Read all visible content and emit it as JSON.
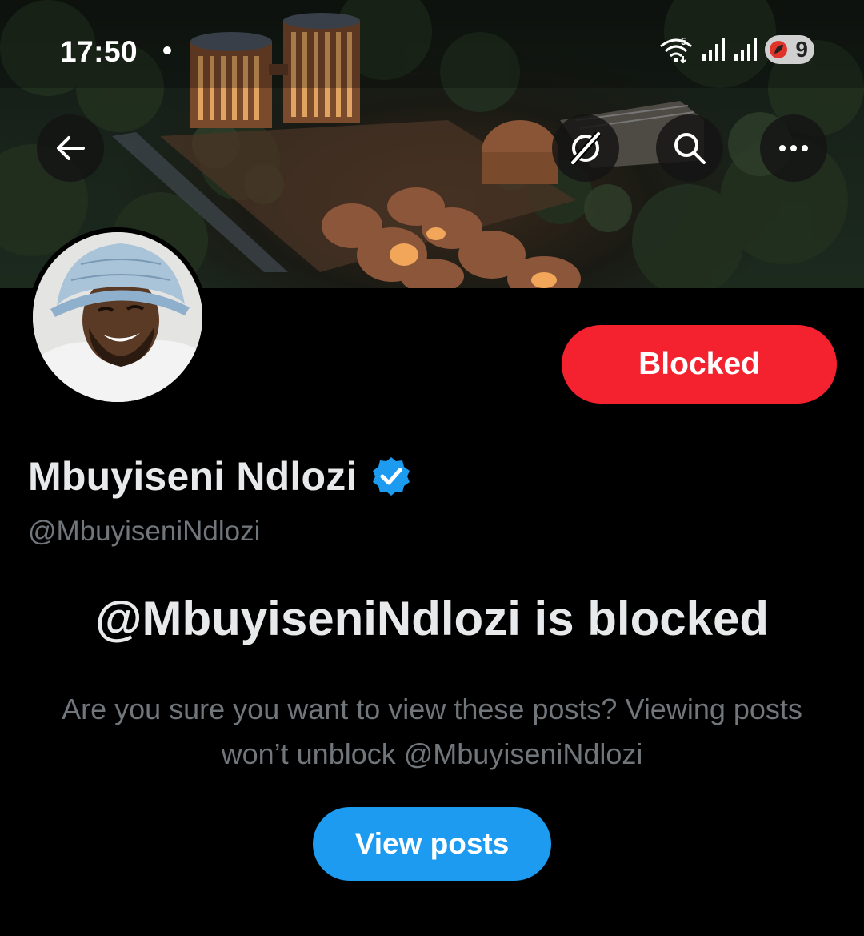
{
  "status_bar": {
    "time": "17:50",
    "wifi_badge": "5",
    "battery_level": "9"
  },
  "banner": {
    "description_icon": "architecture-photo"
  },
  "header_actions": {
    "back_icon": "arrow-left-icon",
    "grok_icon": "grok-icon",
    "search_icon": "search-icon",
    "more_icon": "more-horizontal-icon"
  },
  "profile": {
    "display_name": "Mbuyiseni Ndlozi",
    "handle": "@MbuyiseniNdlozi",
    "verified": true,
    "blocked_button_label": "Blocked"
  },
  "blocked_notice": {
    "title": "@MbuyiseniNdlozi is blocked",
    "description": "Are you sure you want to view these posts? Viewing posts won’t unblock @MbuyiseniNdlozi",
    "view_button_label": "View posts"
  },
  "colors": {
    "background": "#000000",
    "blocked_red": "#f4212e",
    "twitter_blue": "#1d9bf0",
    "secondary_text": "#71767b",
    "primary_text": "#e7e9ea"
  }
}
